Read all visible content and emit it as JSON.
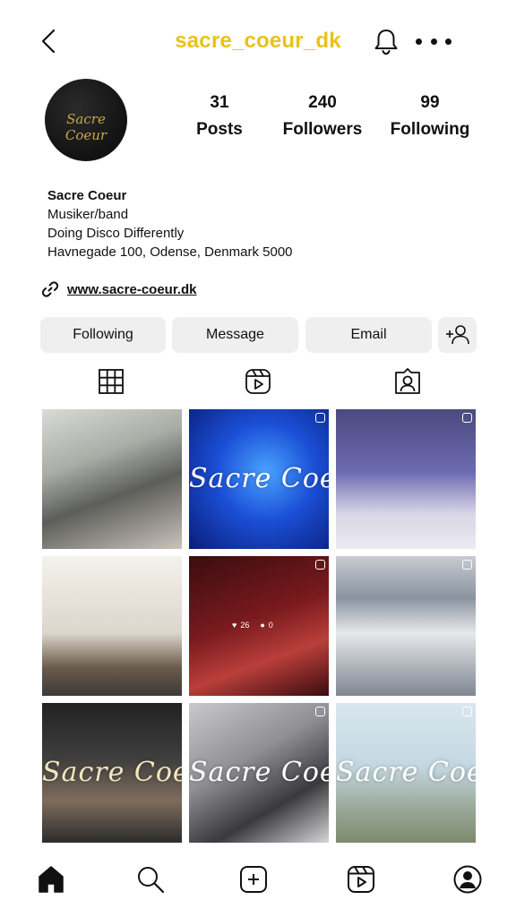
{
  "header": {
    "username": "sacre_coeur_dk",
    "accent_color": "#e8c21a"
  },
  "profile": {
    "avatar_text": "Sacre Coeur",
    "avatar_text_color": "#c9a64a",
    "stats": [
      {
        "number": "31",
        "label": "Posts"
      },
      {
        "number": "240",
        "label": "Followers"
      },
      {
        "number": "99",
        "label": "Following"
      }
    ],
    "bio": {
      "name": "Sacre Coeur",
      "category": "Musiker/band",
      "tagline": "Doing Disco Differently",
      "address": "Havnegade 100, Odense, Denmark 5000"
    },
    "link": "www.sacre-coeur.dk"
  },
  "actions": {
    "following": "Following",
    "message": "Message",
    "email": "Email"
  },
  "grid": {
    "overlay_text": "Sacre Coeur",
    "post5_likes": "26",
    "post5_comments": "0"
  },
  "icons": {
    "back": "back-arrow-icon",
    "bell": "bell-icon",
    "more": "more-dots-icon",
    "grid": "grid-icon",
    "reels": "reels-icon",
    "tagged": "tagged-icon",
    "home": "home-icon",
    "search": "search-icon",
    "create": "create-icon",
    "profile": "profile-icon"
  }
}
